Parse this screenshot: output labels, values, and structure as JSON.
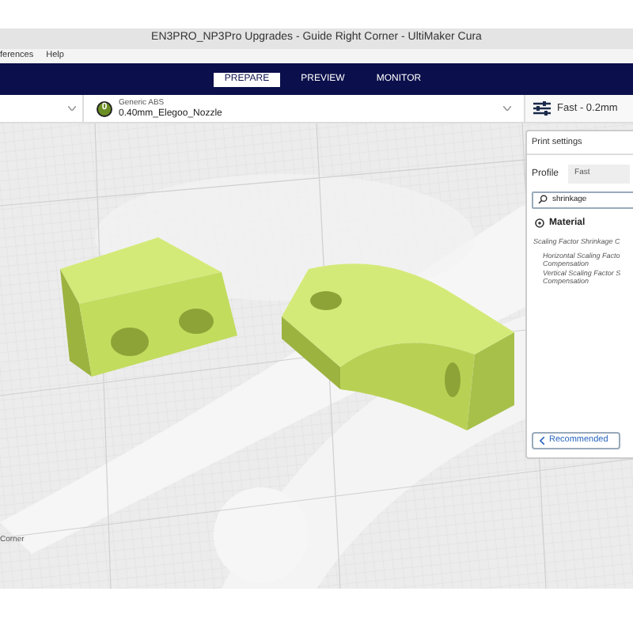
{
  "window": {
    "title": "EN3PRO_NP3Pro Upgrades - Guide Right Corner - UltiMaker Cura"
  },
  "menu": [
    "ferences",
    "Help"
  ],
  "stages": [
    {
      "label": "PREPARE",
      "selected": true
    },
    {
      "label": "PREVIEW",
      "selected": false
    },
    {
      "label": "MONITOR",
      "selected": false
    }
  ],
  "extruder": {
    "number": "0",
    "material": "Generic ABS",
    "nozzle": "0.40mm_Elegoo_Nozzle"
  },
  "profile_summary": "Fast - 0.2mm",
  "print_settings": {
    "title": "Print settings",
    "profile_label": "Profile",
    "profile_value": "Fast",
    "search": {
      "value": "shrinkage"
    },
    "category": "Material",
    "setting": "Scaling Factor Shrinkage C",
    "children": [
      [
        "Horizontal Scaling Facto",
        "Compensation"
      ],
      [
        "Vertical Scaling Factor S",
        "Compensation"
      ]
    ],
    "button": "Recommended"
  },
  "object_label": "Corner"
}
